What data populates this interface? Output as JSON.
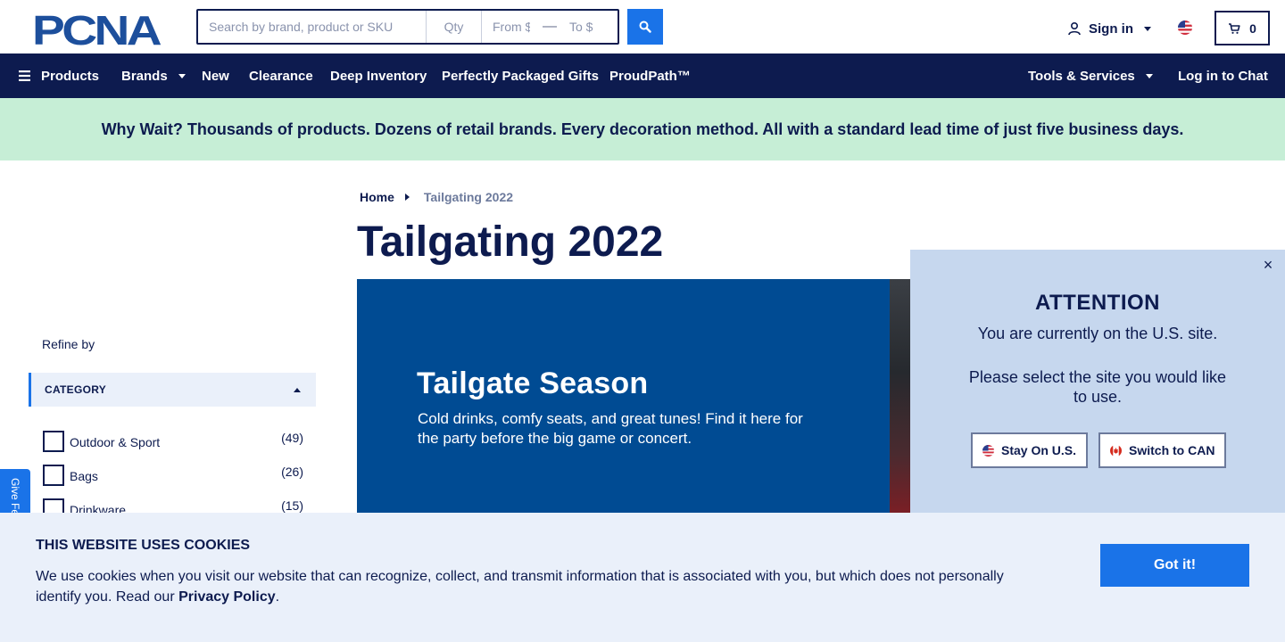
{
  "header": {
    "logo_text": "PCNA",
    "search": {
      "placeholder": "Search by brand, product or SKU",
      "value": ""
    },
    "qty": {
      "placeholder": "Qty"
    },
    "price_from": {
      "placeholder": "From $"
    },
    "price_dash": "—",
    "price_to": {
      "placeholder": "To $"
    },
    "sign_in_label": "Sign in",
    "cart_count": "0"
  },
  "nav": {
    "products": "Products",
    "brands": "Brands",
    "new": "New",
    "clearance": "Clearance",
    "deep_inventory": "Deep Inventory",
    "gifts": "Perfectly Packaged Gifts",
    "proudpath": "ProudPath™",
    "tools": "Tools & Services",
    "chat": "Log in to Chat"
  },
  "promo": "Why Wait? Thousands of products. Dozens of retail brands. Every decoration method. All with a standard lead time of just five business days.",
  "breadcrumb": {
    "home": "Home",
    "current": "Tailgating 2022"
  },
  "page_title": "Tailgating 2022",
  "hero": {
    "title": "Tailgate Season",
    "text": "Cold drinks, comfy seats, and great tunes! Find it here for the party before the big game or concert."
  },
  "sidebar": {
    "refine_label": "Refine by",
    "category_header": "CATEGORY",
    "categories": [
      {
        "label": "Outdoor & Sport",
        "count": "(49)"
      },
      {
        "label": "Bags",
        "count": "(26)"
      },
      {
        "label": "Drinkware",
        "count": "(15)"
      }
    ],
    "feedback": "Give Feedback"
  },
  "attention": {
    "close": "×",
    "title": "ATTENTION",
    "line1": "You are currently on the U.S. site.",
    "line2": "Please select the site you would like to use.",
    "stay_us": "Stay On U.S.",
    "switch_can": "Switch to CAN"
  },
  "cookie": {
    "title": "THIS WEBSITE USES COOKIES",
    "text": "We use cookies when you visit our website that can recognize, collect, and transmit information that is associated with you, but which does not personally identify you. Read our ",
    "link": "Privacy Policy",
    "end": ".",
    "button": "Got it!"
  },
  "colors": {
    "navy": "#0d1b4f",
    "accent_blue": "#1a73e8",
    "promo_green": "#c6eed6",
    "hero_blue": "#004b93",
    "attention_bg": "#c6d7ee",
    "cookie_bg": "#eaf0fa"
  },
  "icons": [
    "hamburger-icon",
    "search-icon",
    "user-icon",
    "us-flag-icon",
    "cart-icon",
    "canada-flag-icon",
    "close-icon"
  ]
}
